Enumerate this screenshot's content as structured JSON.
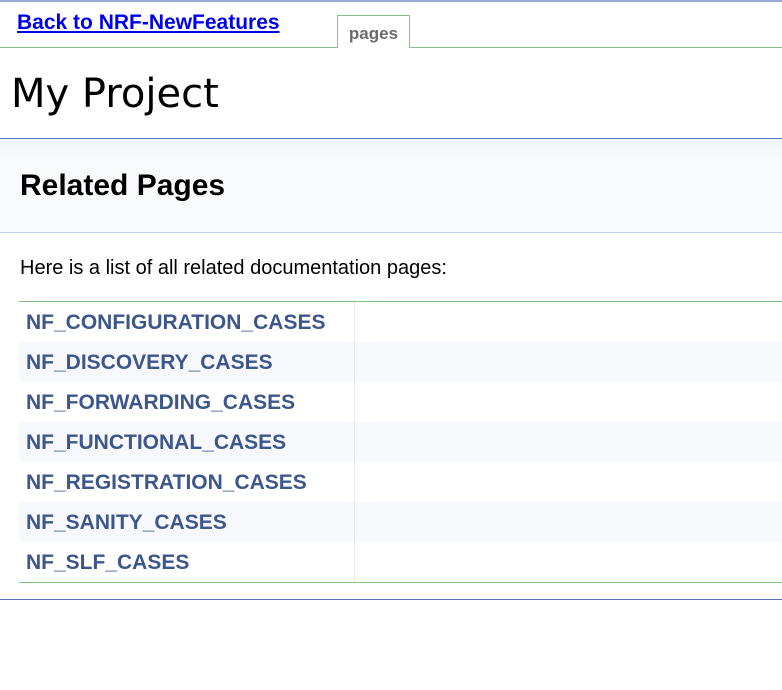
{
  "nav": {
    "back_link": "Back to NRF-NewFeatures",
    "tab_label": "pages"
  },
  "project": {
    "title": "My Project"
  },
  "header": {
    "title": "Related Pages"
  },
  "content": {
    "intro": "Here is a list of all related documentation pages:",
    "pages": [
      "NF_CONFIGURATION_CASES",
      "NF_DISCOVERY_CASES",
      "NF_FORWARDING_CASES",
      "NF_FUNCTIONAL_CASES",
      "NF_REGISTRATION_CASES",
      "NF_SANITY_CASES",
      "NF_SLF_CASES"
    ]
  },
  "colors": {
    "link": "#3d578c",
    "back_link": "#0000ee",
    "rule_green": "#84c283",
    "rule_blue": "#5373b4"
  }
}
